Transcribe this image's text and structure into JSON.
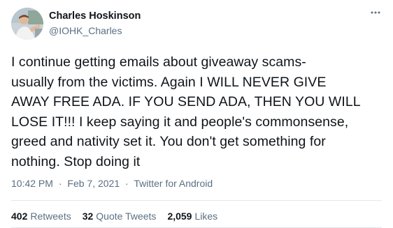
{
  "author": {
    "name": "Charles Hoskinson",
    "handle": "@IOHK_Charles",
    "avatar_icon": "profile-photo"
  },
  "more_icon": "more-options-icon",
  "tweet": {
    "lines": [
      "I continue getting emails about giveaway scams-",
      "usually from the victims. Again I WILL NEVER GIVE",
      "AWAY FREE ADA. IF YOU SEND ADA, THEN YOU WILL",
      "LOSE IT!!! I keep saying it and people's commonsense,",
      "greed and nativity set it. You don't get something for",
      "nothing. Stop doing it"
    ]
  },
  "meta": {
    "time": "10:42 PM",
    "separator": "·",
    "date": "Feb 7, 2021",
    "source": "Twitter for Android"
  },
  "stats": {
    "retweets": {
      "count": "402",
      "label": "Retweets"
    },
    "quote_tweets": {
      "count": "32",
      "label": "Quote Tweets"
    },
    "likes": {
      "count": "2,059",
      "label": "Likes"
    }
  },
  "colors": {
    "text_primary": "#0f1419",
    "text_secondary": "#5b7083",
    "divider": "#e1e8ed"
  }
}
